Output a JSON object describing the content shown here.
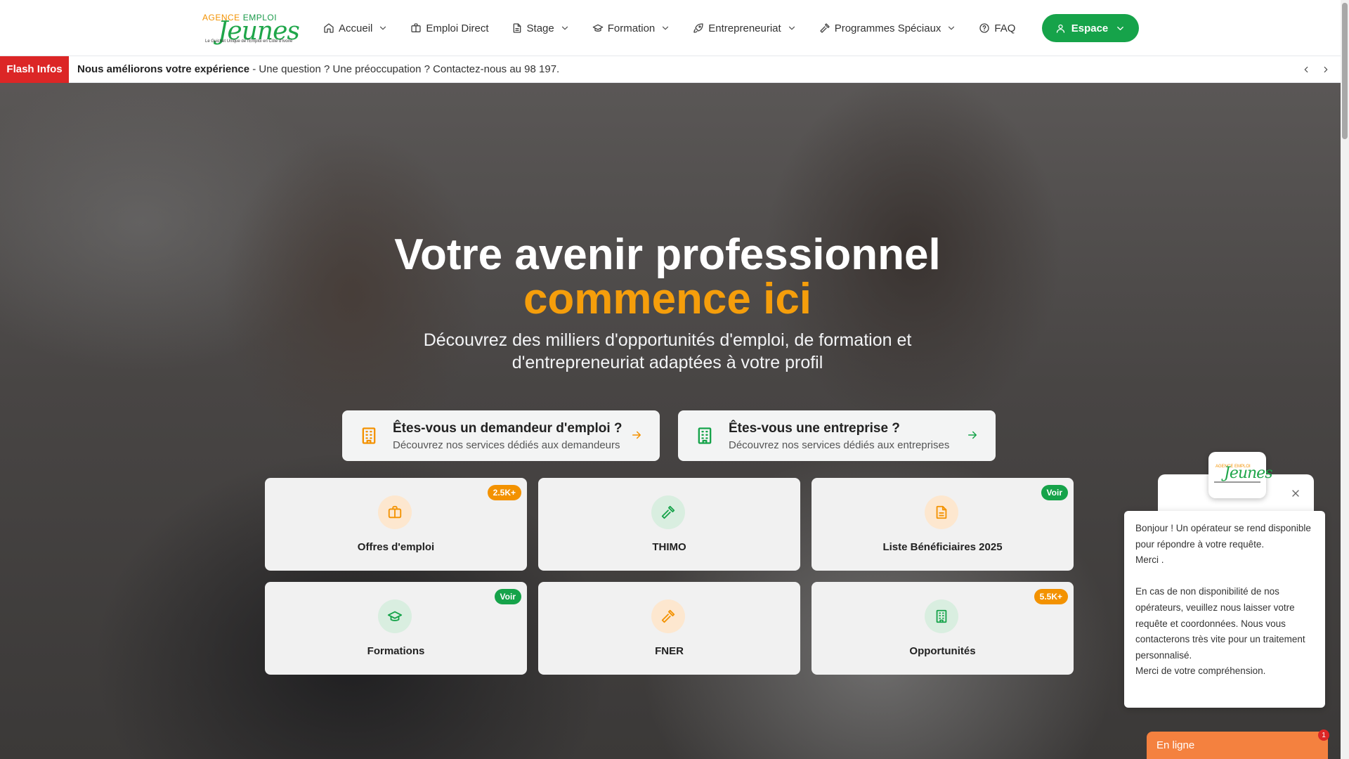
{
  "logo": {
    "top_left": "AGENCE",
    "top_right": "EMPLOI",
    "main": "Jeunes",
    "tagline": "Le Guichet Unique de l'Emploi en Côte d'Ivoire"
  },
  "nav": {
    "items": [
      {
        "label": "Accueil",
        "icon": "home-icon",
        "dropdown": true
      },
      {
        "label": "Emploi Direct",
        "icon": "briefcase-icon",
        "dropdown": false
      },
      {
        "label": "Stage",
        "icon": "document-icon",
        "dropdown": true
      },
      {
        "label": "Formation",
        "icon": "graduation-cap-icon",
        "dropdown": true
      },
      {
        "label": "Entrepreneuriat",
        "icon": "rocket-icon",
        "dropdown": true
      },
      {
        "label": "Programmes Spéciaux",
        "icon": "hammer-icon",
        "dropdown": true
      },
      {
        "label": "FAQ",
        "icon": "help-circle-icon",
        "dropdown": false
      }
    ],
    "espace_label": "Espace"
  },
  "flash": {
    "label": "Flash Infos",
    "headline": "Nous améliorons votre expérience",
    "message": " - Une question ? Une préoccupation ? Contactez-nous au 98 197."
  },
  "hero": {
    "title_line1": "Votre avenir professionnel",
    "title_line2": "commence ici",
    "subtitle": "Découvrez des milliers d'opportunités d'emploi, de formation et d'entrepreneuriat adaptées à votre profil"
  },
  "cta": [
    {
      "title": "Êtes-vous un demandeur d'emploi ?",
      "desc": "Découvrez nos services dédiés aux demandeurs",
      "icon": "building-icon",
      "color": "#f39200"
    },
    {
      "title": "Êtes-vous une entreprise ?",
      "desc": "Découvrez nos services dédiés aux entreprises",
      "icon": "building-icon",
      "color": "#16a34a"
    }
  ],
  "cards": [
    {
      "label": "Offres d'emploi",
      "badge": "2.5K+",
      "badge_color": "#f39200",
      "icon": "briefcase-icon"
    },
    {
      "label": "THIMO",
      "badge": "",
      "icon": "hammer-icon"
    },
    {
      "label": "Liste Bénéficiaires 2025",
      "badge": "Voir",
      "badge_color": "#16a34a",
      "icon": "document-icon"
    },
    {
      "label": "Formations",
      "badge": "Voir",
      "badge_color": "#16a34a",
      "icon": "graduation-cap-icon"
    },
    {
      "label": "FNER",
      "badge": "",
      "icon": "hammer-icon"
    },
    {
      "label": "Opportunités",
      "badge": "5.5K+",
      "badge_color": "#f39200",
      "icon": "building-icon"
    }
  ],
  "chat": {
    "logo_main": "Jeunes",
    "logo_small": "AGENCE EMPLOI",
    "message_lines": [
      "Bonjour ! Un opérateur se rend disponible pour répondre à votre requête.",
      "Merci .",
      "",
      "En cas de non disponibilité de nos opérateurs, veuillez nous laisser votre requête et coordonnées. Nous vous contacterons très vite pour un traitement personnalisé.",
      "Merci de votre compréhension."
    ],
    "tab_label": "En ligne",
    "unread_count": "1"
  }
}
